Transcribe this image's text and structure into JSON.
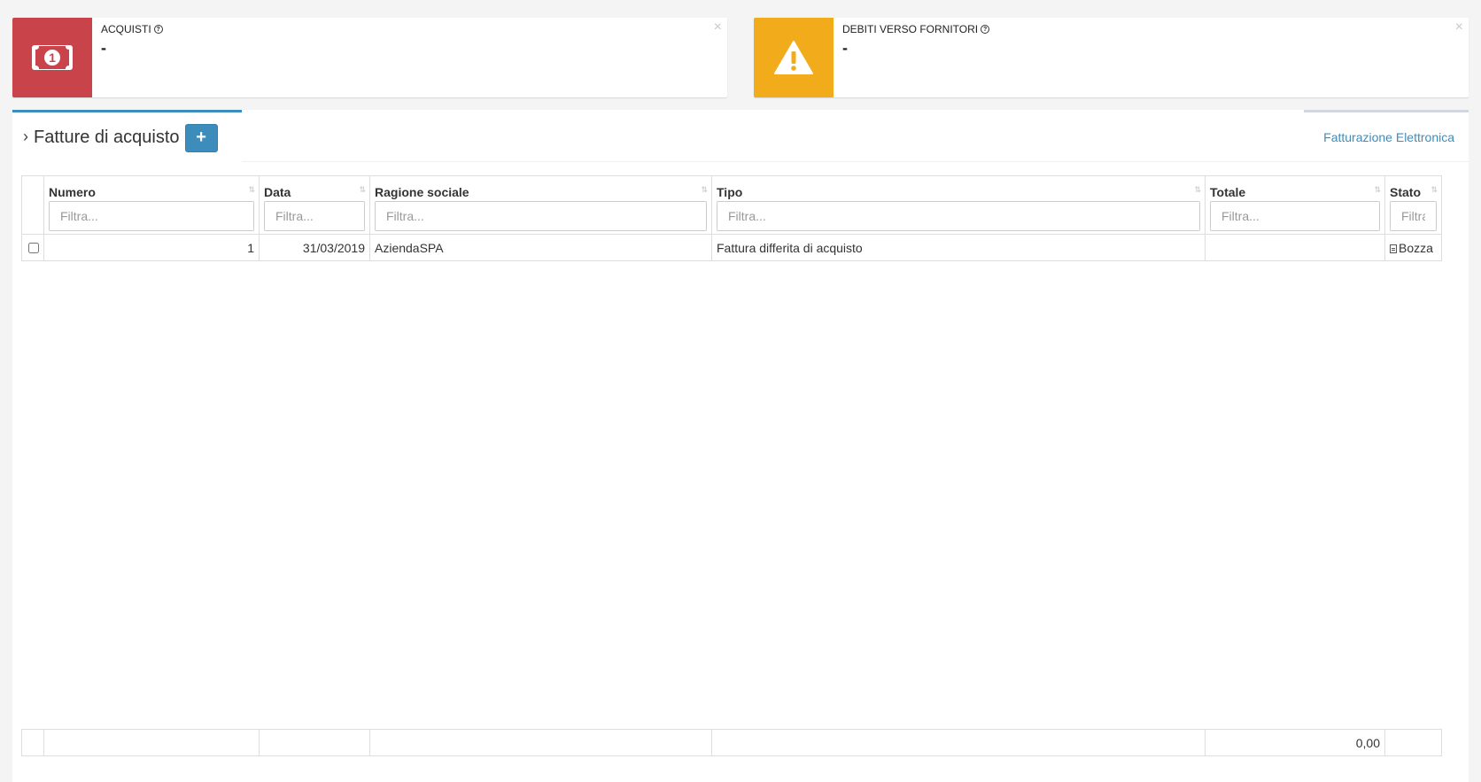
{
  "info_boxes": [
    {
      "title": "ACQUISTI",
      "value": "-",
      "icon": "banknote-icon",
      "color": "#c9434b"
    },
    {
      "title": "DEBITI VERSO FORNITORI",
      "value": "-",
      "icon": "warning-icon",
      "color": "#f2ac1b"
    }
  ],
  "info_close": "×",
  "help_symbol": "?",
  "tabs": {
    "active": "Fatture di acquisto",
    "add_label": "+",
    "chevron": "›",
    "right": "Fatturazione Elettronica"
  },
  "table": {
    "columns": [
      "Numero",
      "Data",
      "Ragione sociale",
      "Tipo",
      "Totale",
      "Stato"
    ],
    "filter_placeholder": "Filtra...",
    "sort_symbol": "⇅",
    "rows": [
      {
        "numero": "1",
        "data": "31/03/2019",
        "ragione_sociale": "AziendaSPA",
        "tipo": "Fattura differita di acquisto",
        "totale": "",
        "stato": "Bozza"
      }
    ],
    "footer_total": "0,00"
  }
}
